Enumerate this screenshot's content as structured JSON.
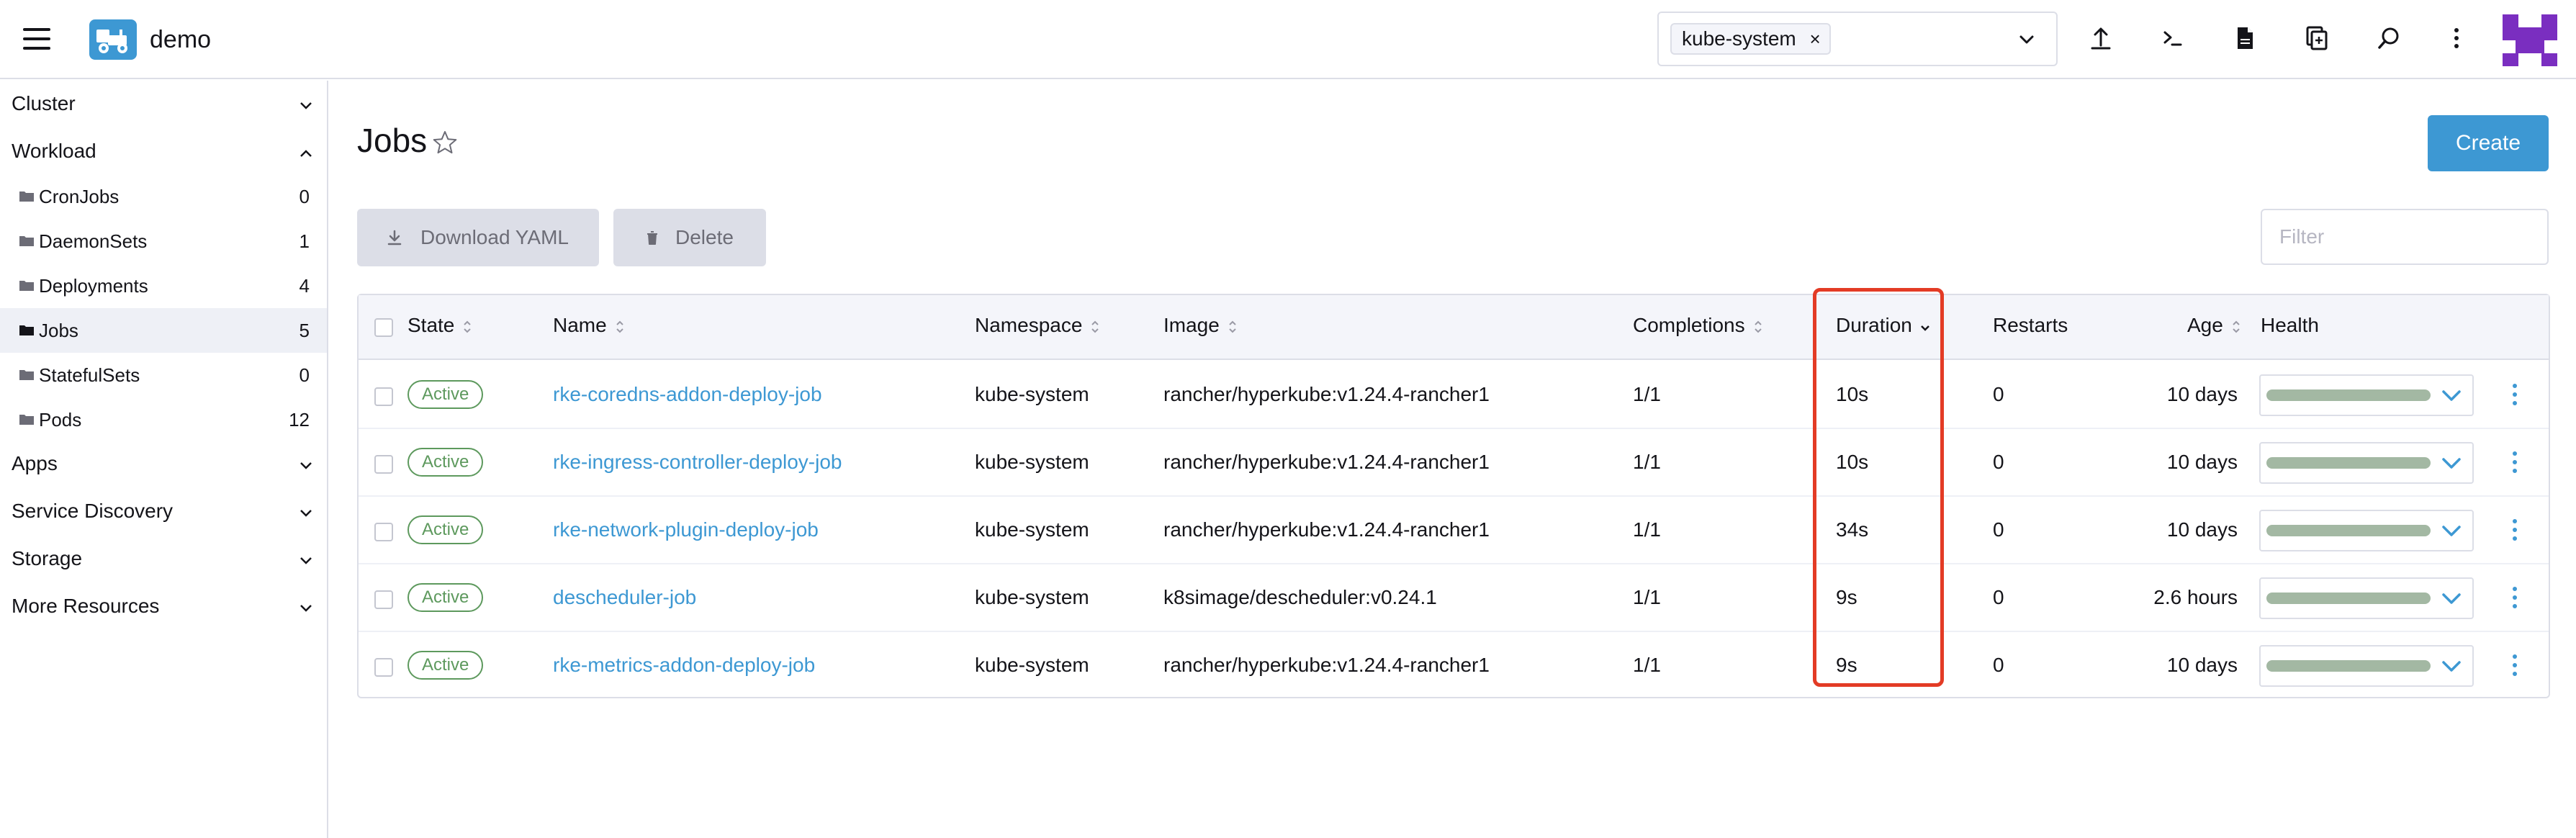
{
  "header": {
    "cluster_name": "demo",
    "namespace_chip": "kube-system",
    "namespace_chip_remove": "×",
    "icons": [
      "menu-icon",
      "cluster-logo-icon",
      "import-yaml-icon",
      "kubectl-shell-icon",
      "kubeconfig-file-icon",
      "copy-kubeconfig-icon",
      "search-icon",
      "more-icon",
      "brand-logo-icon"
    ]
  },
  "sidebar": {
    "groups": {
      "cluster": "Cluster",
      "workload": "Workload",
      "apps": "Apps",
      "service_discovery": "Service Discovery",
      "storage": "Storage",
      "more_resources": "More Resources"
    },
    "workload_items": [
      {
        "label": "CronJobs",
        "count": "0"
      },
      {
        "label": "DaemonSets",
        "count": "1"
      },
      {
        "label": "Deployments",
        "count": "4"
      },
      {
        "label": "Jobs",
        "count": "5"
      },
      {
        "label": "StatefulSets",
        "count": "0"
      },
      {
        "label": "Pods",
        "count": "12"
      }
    ],
    "active_item": "Jobs"
  },
  "main": {
    "title": "Jobs",
    "create_label": "Create",
    "download_yaml_label": "Download YAML",
    "delete_label": "Delete",
    "filter_placeholder": "Filter"
  },
  "table": {
    "columns": {
      "state": "State",
      "name": "Name",
      "namespace": "Namespace",
      "image": "Image",
      "completions": "Completions",
      "duration": "Duration",
      "restarts": "Restarts",
      "age": "Age",
      "health": "Health"
    },
    "rows": [
      {
        "state": "Active",
        "name": "rke-coredns-addon-deploy-job",
        "namespace": "kube-system",
        "image": "rancher/hyperkube:v1.24.4-rancher1",
        "completions": "1/1",
        "duration": "10s",
        "restarts": "0",
        "age": "10 days"
      },
      {
        "state": "Active",
        "name": "rke-ingress-controller-deploy-job",
        "namespace": "kube-system",
        "image": "rancher/hyperkube:v1.24.4-rancher1",
        "completions": "1/1",
        "duration": "10s",
        "restarts": "0",
        "age": "10 days"
      },
      {
        "state": "Active",
        "name": "rke-network-plugin-deploy-job",
        "namespace": "kube-system",
        "image": "rancher/hyperkube:v1.24.4-rancher1",
        "completions": "1/1",
        "duration": "34s",
        "restarts": "0",
        "age": "10 days"
      },
      {
        "state": "Active",
        "name": "descheduler-job",
        "namespace": "kube-system",
        "image": "k8simage/descheduler:v0.24.1",
        "completions": "1/1",
        "duration": "9s",
        "restarts": "0",
        "age": "2.6 hours"
      },
      {
        "state": "Active",
        "name": "rke-metrics-addon-deploy-job",
        "namespace": "kube-system",
        "image": "rancher/hyperkube:v1.24.4-rancher1",
        "completions": "1/1",
        "duration": "9s",
        "restarts": "0",
        "age": "10 days"
      }
    ]
  },
  "colors": {
    "accent": "#3d98d3",
    "active_badge": "#5d995d",
    "highlight_box": "#e33b25",
    "brand_logo": "#7a2ec0"
  }
}
